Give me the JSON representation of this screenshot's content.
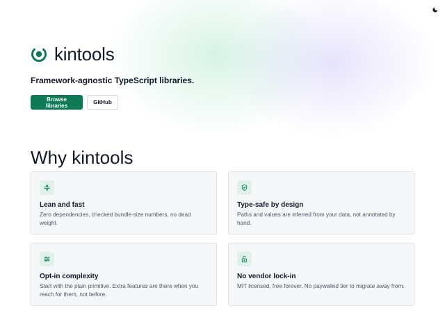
{
  "brand": {
    "name": "kintools",
    "accent": "#0e7a55"
  },
  "hero": {
    "tagline": "Framework-agnostic TypeScript libraries.",
    "primary_button": "Browse libraries",
    "secondary_button": "GitHub"
  },
  "header": {
    "theme_toggle_icon": "moon-icon"
  },
  "why": {
    "title": "Why kintools",
    "cards": [
      {
        "icon": "compress-icon",
        "title": "Lean and fast",
        "text": "Zero dependencies, checked bundle-size numbers, no dead weight."
      },
      {
        "icon": "shield-check-icon",
        "title": "Type-safe by design",
        "text": "Paths and values are inferred from your data, not annotated by hand."
      },
      {
        "icon": "sliders-icon",
        "title": "Opt-in complexity",
        "text": "Start with the plain primitive. Extra features are there when you reach for them, not before."
      },
      {
        "icon": "unlock-icon",
        "title": "No vendor lock-in",
        "text": "MIT licensed, free forever. No paywalled tier to migrate away from."
      }
    ]
  }
}
